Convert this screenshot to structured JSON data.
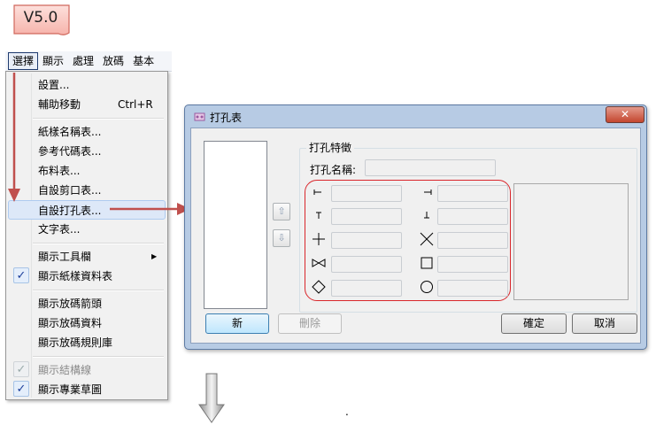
{
  "version_badge": "V5.0",
  "menubar": {
    "items": [
      {
        "label": "選擇"
      },
      {
        "label": "顯示"
      },
      {
        "label": "處理"
      },
      {
        "label": "放碼"
      },
      {
        "label": "基本"
      }
    ]
  },
  "menu": {
    "items": [
      {
        "label": "設置..."
      },
      {
        "label": "輔助移動",
        "shortcut": "Ctrl+R"
      },
      {
        "label": "紙樣名稱表..."
      },
      {
        "label": "參考代碼表..."
      },
      {
        "label": "布料表..."
      },
      {
        "label": "自設剪口表..."
      },
      {
        "label": "自設打孔表..."
      },
      {
        "label": "文字表..."
      },
      {
        "label": "顯示工具欄"
      },
      {
        "label": "顯示紙樣資料表"
      },
      {
        "label": "顯示放碼箭頭"
      },
      {
        "label": "顯示放碼資料"
      },
      {
        "label": "顯示放碼規則庫"
      },
      {
        "label": "顯示結構線"
      },
      {
        "label": "顯示專業草圖"
      }
    ],
    "check_glyph": "✓"
  },
  "dialog": {
    "title": "打孔表",
    "close_glyph": "✕",
    "group_label": "打孔特徵",
    "name_label": "打孔名稱:",
    "up_glyph": "⇧",
    "down_glyph": "⇩",
    "buttons": {
      "new": "新",
      "delete": "刪除",
      "ok": "確定",
      "cancel": "取消"
    }
  },
  "footnote": "."
}
